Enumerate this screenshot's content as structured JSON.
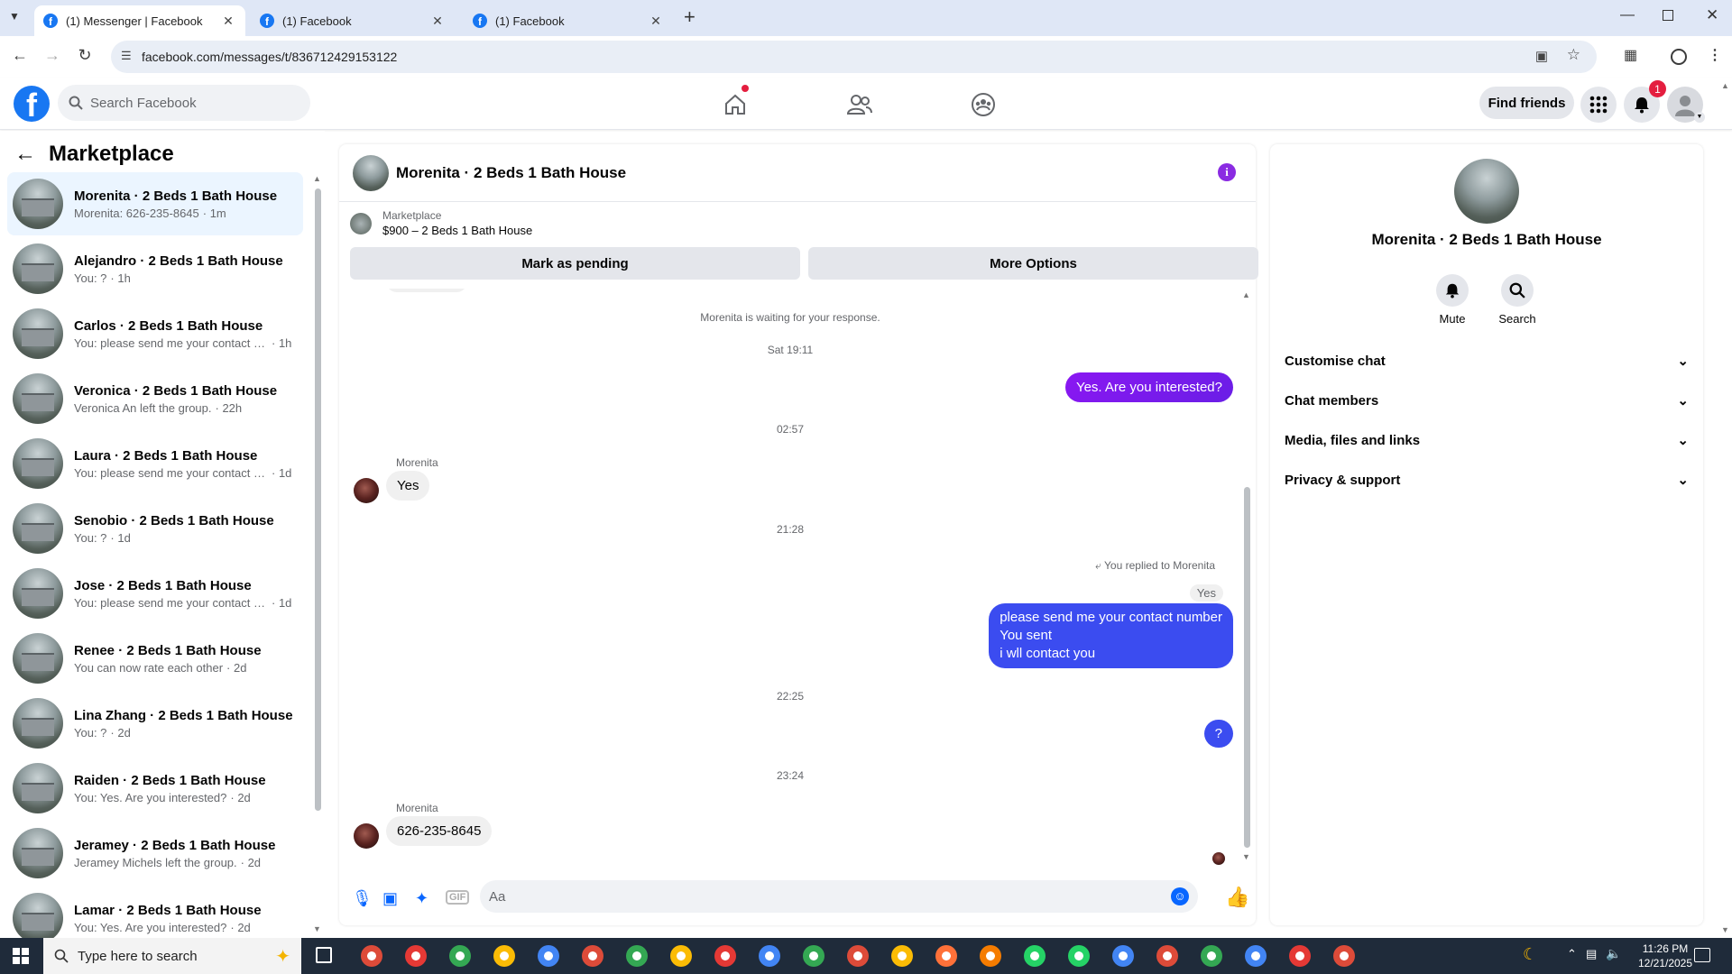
{
  "browser": {
    "tabs": [
      {
        "title": "(1) Messenger | Facebook",
        "active": true
      },
      {
        "title": "(1) Facebook",
        "active": false
      },
      {
        "title": "(1) Facebook",
        "active": false
      }
    ],
    "url": "facebook.com/messages/t/836712429153122"
  },
  "fb": {
    "search_placeholder": "Search Facebook",
    "find_friends": "Find friends",
    "notification_count": "1"
  },
  "left": {
    "title": "Marketplace",
    "conversations": [
      {
        "name": "Morenita · 2 Beds 1 Bath House",
        "preview": "Morenita: 626-235-8645",
        "time": "· 1m",
        "selected": true
      },
      {
        "name": "Alejandro · 2 Beds 1 Bath House",
        "preview": "You: ?",
        "time": "· 1h"
      },
      {
        "name": "Carlos · 2 Beds 1 Bath House",
        "preview": "You: please send me your contact n...",
        "time": "· 1h"
      },
      {
        "name": "Veronica · 2 Beds 1 Bath House",
        "preview": "Veronica An left the group.",
        "time": "· 22h"
      },
      {
        "name": "Laura · 2 Beds 1 Bath House",
        "preview": "You: please send me your contact n...",
        "time": "· 1d"
      },
      {
        "name": "Senobio · 2 Beds 1 Bath House",
        "preview": "You: ?",
        "time": "· 1d"
      },
      {
        "name": "Jose · 2 Beds 1 Bath House",
        "preview": "You: please send me your contact n...",
        "time": "· 1d"
      },
      {
        "name": "Renee · 2 Beds 1 Bath House",
        "preview": "You can now rate each other",
        "time": "· 2d"
      },
      {
        "name": "Lina Zhang · 2 Beds 1 Bath House",
        "preview": "You: ?",
        "time": "· 2d"
      },
      {
        "name": "Raiden · 2 Beds 1 Bath House",
        "preview": "You: Yes. Are you interested?",
        "time": "· 2d"
      },
      {
        "name": "Jeramey · 2 Beds 1 Bath House",
        "preview": "Jeramey Michels left the group.",
        "time": "· 2d"
      },
      {
        "name": "Lamar · 2 Beds 1 Bath House",
        "preview": "You: Yes. Are you interested?",
        "time": "· 2d"
      }
    ]
  },
  "chat": {
    "title": "Morenita · 2 Beds 1 Bath House",
    "marketplace_label": "Marketplace",
    "listing": "$900 – 2 Beds 1 Bath House",
    "mark_pending": "Mark as pending",
    "more_options": "More Options",
    "waiting": "Morenita is waiting for your response.",
    "ts1": "Sat 19:11",
    "msg1": "Yes. Are you interested?",
    "ts2": "02:57",
    "sender": "Morenita",
    "msg2": "Yes",
    "ts3": "21:28",
    "replied": "You replied to Morenita",
    "quoted": "Yes",
    "msg3_line1": "please send me your contact number",
    "msg3_line2": "You sent",
    "msg3_line3": "i wll contact you",
    "ts4": "22:25",
    "msg4": "?",
    "ts5": "23:24",
    "msg5": "626-235-8645",
    "composer_placeholder": "Aa"
  },
  "right": {
    "name": "Morenita · 2 Beds 1 Bath House",
    "mute": "Mute",
    "search": "Search",
    "sections": [
      "Customise chat",
      "Chat members",
      "Media, files and links",
      "Privacy & support"
    ]
  },
  "taskbar": {
    "search_placeholder": "Type here to search",
    "time": "11:26 PM",
    "date": "12/21/2025"
  }
}
